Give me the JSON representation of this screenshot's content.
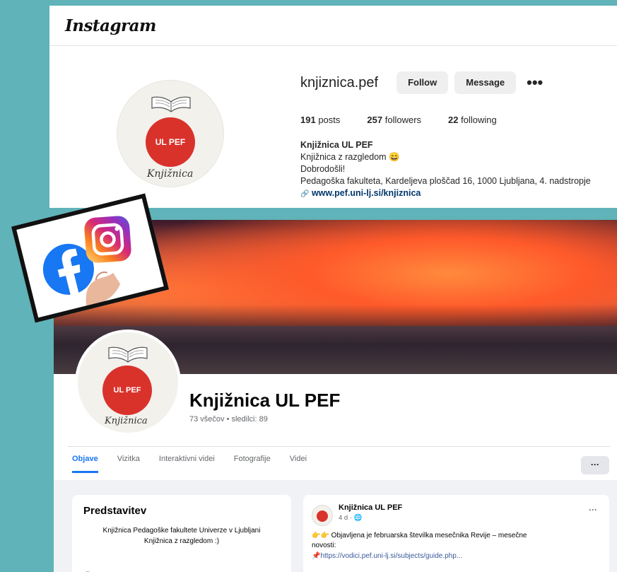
{
  "instagram": {
    "brand": "Instagram",
    "username": "knjiznica.pef",
    "follow_label": "Follow",
    "message_label": "Message",
    "more_label": "•••",
    "stats": {
      "posts": "191",
      "posts_label": "posts",
      "followers": "257",
      "followers_label": "followers",
      "following": "22",
      "following_label": "following"
    },
    "bio": {
      "name": "Knjižnica UL PEF",
      "tagline": "Knjižnica z razgledom 😄",
      "welcome": "Dobrodošli!",
      "address": "Pedagoška fakulteta, Kardeljeva ploščad 16, 1000 Ljubljana, 4. nadstropje",
      "link_icon": "🔗",
      "link": "www.pef.uni-lj.si/knjiznica"
    }
  },
  "logo": {
    "badge": "UL PEF",
    "script": "Knjižnica"
  },
  "facebook": {
    "page_name": "Knjižnica UL PEF",
    "subtitle": "73 všečov • sledilci: 89",
    "tabs": [
      "Objave",
      "Vizitka",
      "Interaktivni videi",
      "Fotografije",
      "Videi"
    ],
    "tab_more": "···",
    "intro_title": "Predstavitev",
    "intro_text_1": "Knjižnica Pedagoške fakultete Univerze v Ljubljani",
    "intro_text_2": "Knjižnica z razgledom :)",
    "post": {
      "author": "Knjižnica UL PEF",
      "time": "4 d · 🌐",
      "more": "···",
      "text_1": "👉👉 Objavljena je februarska številka mesečnika Revije – mesečne",
      "text_2": "novosti:",
      "link": "📌https://vodici.pef.uni-lj.si/subjects/guide.php..."
    }
  },
  "colors": {
    "accent": "#1877f2",
    "logo_red": "#d9322b",
    "background": "#5fb3b9"
  }
}
